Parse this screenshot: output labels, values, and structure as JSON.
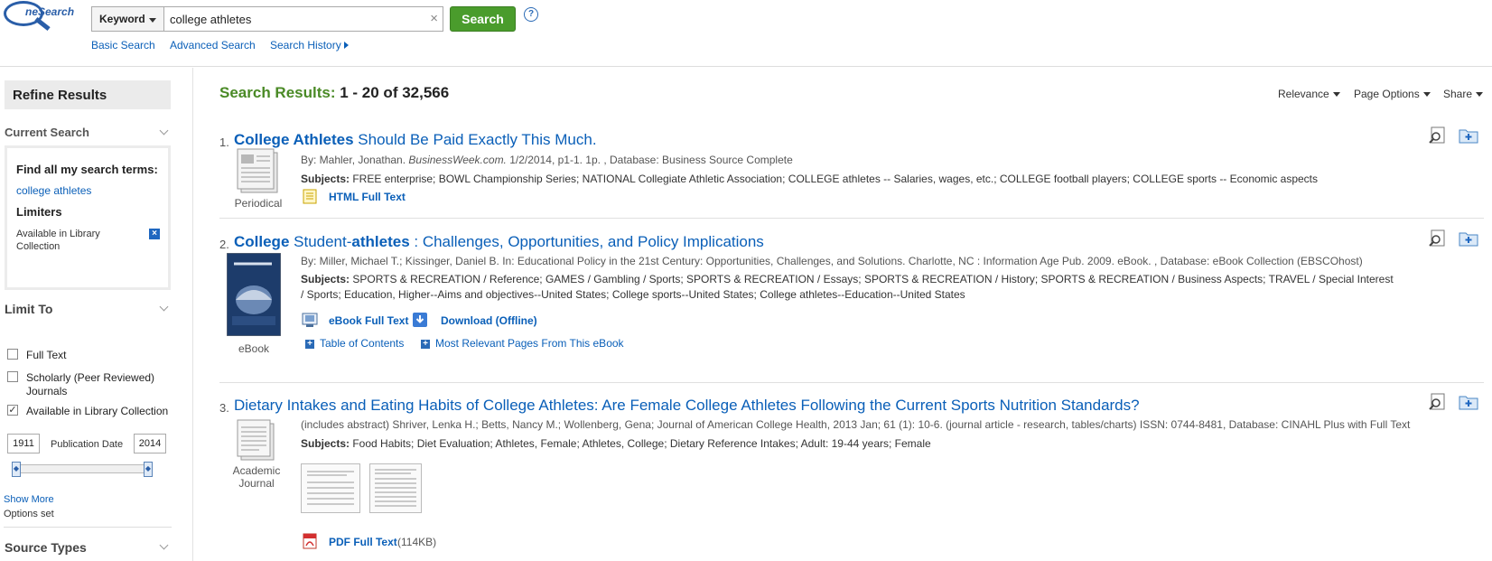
{
  "header": {
    "logo_text": "neSearch",
    "search_field_option": "Keyword",
    "search_query": "college athletes",
    "search_button": "Search",
    "help": "?",
    "clear": "×",
    "links": {
      "basic": "Basic Search",
      "advanced": "Advanced Search",
      "history": "Search History"
    }
  },
  "sidebar": {
    "refine_title": "Refine Results",
    "current_search_title": "Current Search",
    "find_all_label": "Find all my search terms:",
    "search_terms": "college athletes",
    "limiters_label": "Limiters",
    "limiter": "Available in Library Collection",
    "limit_to_title": "Limit To",
    "checkboxes": [
      {
        "label": "Full Text",
        "checked": false
      },
      {
        "label": "Scholarly (Peer Reviewed) Journals",
        "checked": false
      },
      {
        "label": "Available in Library Collection",
        "checked": true
      }
    ],
    "date_from": "1911",
    "date_label": "Publication Date",
    "date_to": "2014",
    "show_more": "Show More",
    "options_set": "Options set",
    "source_types_title": "Source Types"
  },
  "results": {
    "heading_label": "Search Results:",
    "heading_count": "1 - 20 of 32,566",
    "sort": "Relevance",
    "page_options": "Page Options",
    "share": "Share",
    "items": [
      {
        "num": "1.",
        "title_b1": "College Athletes",
        "title_r1": " Should Be Paid Exactly This Much.",
        "meta_pre": "By: Mahler, Jonathan. ",
        "meta_src": "BusinessWeek.com.",
        "meta_post": " 1/2/2014, p1-1. 1p. , Database: Business Source Complete",
        "subjects_label": "Subjects:",
        "subjects": " FREE enterprise; BOWL Championship Series; NATIONAL Collegiate Athletic Association; COLLEGE athletes -- Salaries, wages, etc.; COLLEGE football players; COLLEGE sports -- Economic aspects",
        "type": "Periodical",
        "fulltext": "HTML Full Text"
      },
      {
        "num": "2.",
        "title_b1": "College",
        "title_r1": " Student-",
        "title_b2": "athletes",
        "title_r2": " : Challenges, Opportunities, and Policy Implications",
        "meta": "By: Miller, Michael T.; Kissinger, Daniel B. In: Educational Policy in the 21st Century: Opportunities, Challenges, and Solutions. Charlotte, NC : Information Age Pub. 2009. eBook. , Database: eBook Collection (EBSCOhost)",
        "subjects_label": "Subjects:",
        "subjects": " SPORTS & RECREATION / Reference; GAMES / Gambling / Sports; SPORTS & RECREATION / Essays; SPORTS & RECREATION / History; SPORTS & RECREATION / Business Aspects; TRAVEL / Special Interest / Sports; Education, Higher--Aims and objectives--United States; College sports--United States; College athletes--Education--United States",
        "type": "eBook",
        "fulltext": "eBook Full Text",
        "download": "Download (Offline)",
        "toc": "Table of Contents",
        "relevant": "Most Relevant Pages From This eBook"
      },
      {
        "num": "3.",
        "title": "Dietary Intakes and Eating Habits of College Athletes: Are Female College Athletes Following the Current Sports Nutrition Standards?",
        "meta": "(includes abstract) Shriver, Lenka H.; Betts, Nancy M.; Wollenberg, Gena; Journal of American College Health, 2013 Jan; 61 (1): 10-6. (journal article - research, tables/charts) ISSN: 0744-8481, Database: CINAHL Plus with Full Text",
        "subjects_label": "Subjects:",
        "subjects": " Food Habits; Diet Evaluation; Athletes, Female; Athletes, College; Dietary Reference Intakes; Adult: 19-44 years; Female",
        "type": "Academic Journal",
        "fulltext": "PDF Full Text",
        "size": "(114KB)"
      }
    ]
  }
}
